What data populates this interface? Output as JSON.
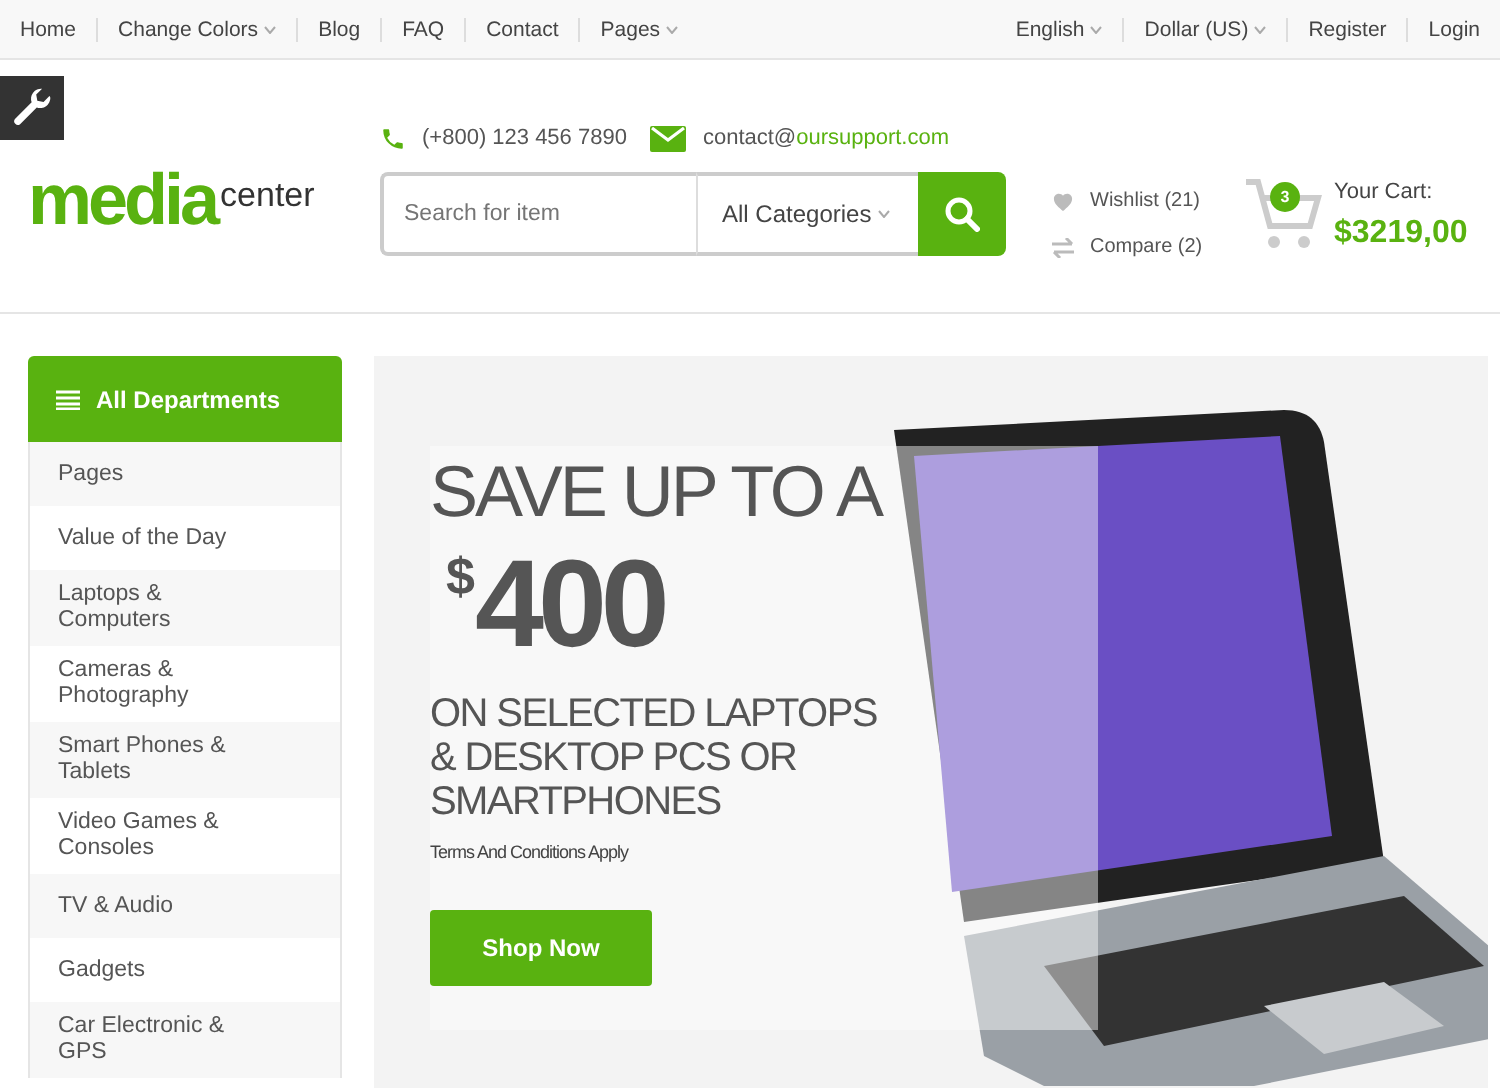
{
  "top_nav": {
    "left": [
      {
        "label": "Home",
        "dropdown": false
      },
      {
        "label": "Change Colors",
        "dropdown": true
      },
      {
        "label": "Blog",
        "dropdown": false
      },
      {
        "label": "FAQ",
        "dropdown": false
      },
      {
        "label": "Contact",
        "dropdown": false
      },
      {
        "label": "Pages",
        "dropdown": true
      }
    ],
    "right": [
      {
        "label": "English",
        "dropdown": true
      },
      {
        "label": "Dollar (US)",
        "dropdown": true
      },
      {
        "label": "Register",
        "dropdown": false
      },
      {
        "label": "Login",
        "dropdown": false
      }
    ]
  },
  "logo": {
    "main": "media",
    "sub": "center"
  },
  "contact": {
    "phone": "(+800) 123 456 7890",
    "email_prefix": "contact@",
    "email_domain": "oursupport.com"
  },
  "search": {
    "placeholder": "Search for item",
    "category": "All Categories"
  },
  "wishlist": "Wishlist (21)",
  "compare": "Compare (2)",
  "cart": {
    "count": "3",
    "label": "Your Cart:",
    "total": "$3219,00"
  },
  "departments": {
    "title": "All Departments",
    "items": [
      "Pages",
      "Value of the Day",
      "Laptops & Computers",
      "Cameras & Photography",
      "Smart Phones & Tablets",
      "Video Games & Consoles",
      "TV & Audio",
      "Gadgets",
      "Car Electronic & GPS"
    ]
  },
  "banner": {
    "headline": "SAVE UP TO A",
    "currency": "$",
    "amount": "400",
    "subline": "ON SELECTED LAPTOPS & DESKTOP PCS OR SMARTPHONES",
    "terms": "Terms And Conditions Apply",
    "button": "Shop Now"
  }
}
